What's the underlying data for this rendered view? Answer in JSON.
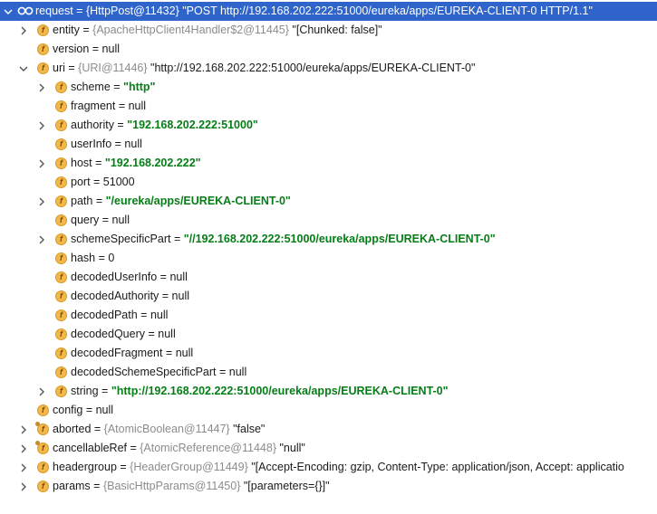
{
  "root": {
    "name": "request",
    "type": "{HttpPost@11432}",
    "value": "\"POST http://192.168.202.222:51000/eureka/apps/EUREKA-CLIENT-0 HTTP/1.1\""
  },
  "rows": [
    {
      "name": "entity",
      "type": "{ApacheHttpClient4Handler$2@11445}",
      "value": "\"[Chunked: false]\"",
      "kind": "plain"
    },
    {
      "name": "version",
      "value": "null",
      "kind": "plain"
    },
    {
      "name": "uri",
      "type": "{URI@11446}",
      "value": "\"http://192.168.202.222:51000/eureka/apps/EUREKA-CLIENT-0\"",
      "kind": "plain"
    },
    {
      "name": "scheme",
      "value": "\"http\"",
      "kind": "str"
    },
    {
      "name": "fragment",
      "value": "null",
      "kind": "plain"
    },
    {
      "name": "authority",
      "value": "\"192.168.202.222:51000\"",
      "kind": "str"
    },
    {
      "name": "userInfo",
      "value": "null",
      "kind": "plain"
    },
    {
      "name": "host",
      "value": "\"192.168.202.222\"",
      "kind": "str"
    },
    {
      "name": "port",
      "value": "51000",
      "kind": "plain"
    },
    {
      "name": "path",
      "value": "\"/eureka/apps/EUREKA-CLIENT-0\"",
      "kind": "str"
    },
    {
      "name": "query",
      "value": "null",
      "kind": "plain"
    },
    {
      "name": "schemeSpecificPart",
      "value": "\"//192.168.202.222:51000/eureka/apps/EUREKA-CLIENT-0\"",
      "kind": "str"
    },
    {
      "name": "hash",
      "value": "0",
      "kind": "plain"
    },
    {
      "name": "decodedUserInfo",
      "value": "null",
      "kind": "plain"
    },
    {
      "name": "decodedAuthority",
      "value": "null",
      "kind": "plain"
    },
    {
      "name": "decodedPath",
      "value": "null",
      "kind": "plain"
    },
    {
      "name": "decodedQuery",
      "value": "null",
      "kind": "plain"
    },
    {
      "name": "decodedFragment",
      "value": "null",
      "kind": "plain"
    },
    {
      "name": "decodedSchemeSpecificPart",
      "value": "null",
      "kind": "plain"
    },
    {
      "name": "string",
      "value": "\"http://192.168.202.222:51000/eureka/apps/EUREKA-CLIENT-0\"",
      "kind": "str"
    },
    {
      "name": "config",
      "value": "null",
      "kind": "plain"
    },
    {
      "name": "aborted",
      "type": "{AtomicBoolean@11447}",
      "value": "\"false\"",
      "kind": "plain"
    },
    {
      "name": "cancellableRef",
      "type": "{AtomicReference@11448}",
      "value": "\"null\"",
      "kind": "plain"
    },
    {
      "name": "headergroup",
      "type": "{HeaderGroup@11449}",
      "value": "\"[Accept-Encoding: gzip, Content-Type: application/json, Accept: applicatio",
      "kind": "plain"
    },
    {
      "name": "params",
      "type": "{BasicHttpParams@11450}",
      "value": "\"[parameters={}]\"",
      "kind": "plain"
    }
  ],
  "colors": {
    "selection": "#2f65ca",
    "string": "#067d17",
    "type": "#8c8c8c",
    "field_icon": "#f2b84b"
  },
  "icons": {
    "field": "field-icon",
    "final_field": "final-field-icon",
    "object": "object-icon",
    "expand": "chevron-right-icon",
    "collapse": "chevron-down-icon"
  }
}
